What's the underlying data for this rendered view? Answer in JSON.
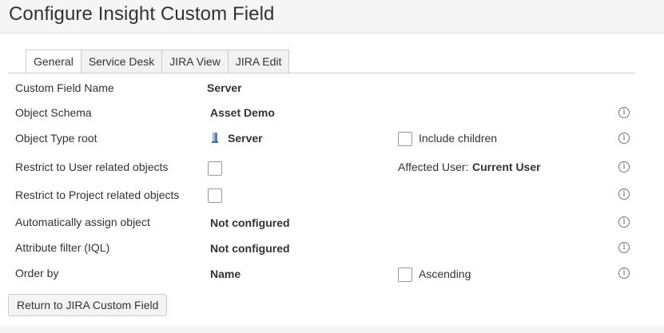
{
  "page": {
    "title": "Configure Insight Custom Field"
  },
  "tabs": [
    {
      "label": "General",
      "active": true
    },
    {
      "label": "Service Desk",
      "active": false
    },
    {
      "label": "JIRA View",
      "active": false
    },
    {
      "label": "JIRA Edit",
      "active": false
    }
  ],
  "rows": {
    "custom_field_name": {
      "label": "Custom Field Name",
      "value": "Server"
    },
    "object_schema": {
      "label": "Object Schema",
      "value": "Asset Demo"
    },
    "object_type_root": {
      "label": "Object Type root",
      "value": "Server",
      "icon": "server-icon",
      "checkbox_label": "Include children",
      "checked": false
    },
    "restrict_user": {
      "label": "Restrict to User related objects",
      "checked": false,
      "affected_label": "Affected User:",
      "affected_value": "Current User"
    },
    "restrict_project": {
      "label": "Restrict to Project related objects",
      "checked": false
    },
    "auto_assign": {
      "label": "Automatically assign object",
      "value": "Not configured"
    },
    "attribute_filter": {
      "label": "Attribute filter (IQL)",
      "value": "Not configured"
    },
    "order_by": {
      "label": "Order by",
      "value": "Name",
      "checkbox_label": "Ascending",
      "checked": false
    }
  },
  "info_glyph": "i",
  "return_button": "Return to JIRA Custom Field",
  "colors": {
    "background": "#f5f5f5",
    "panel": "#ffffff",
    "border": "#cccccc",
    "text": "#333333"
  }
}
